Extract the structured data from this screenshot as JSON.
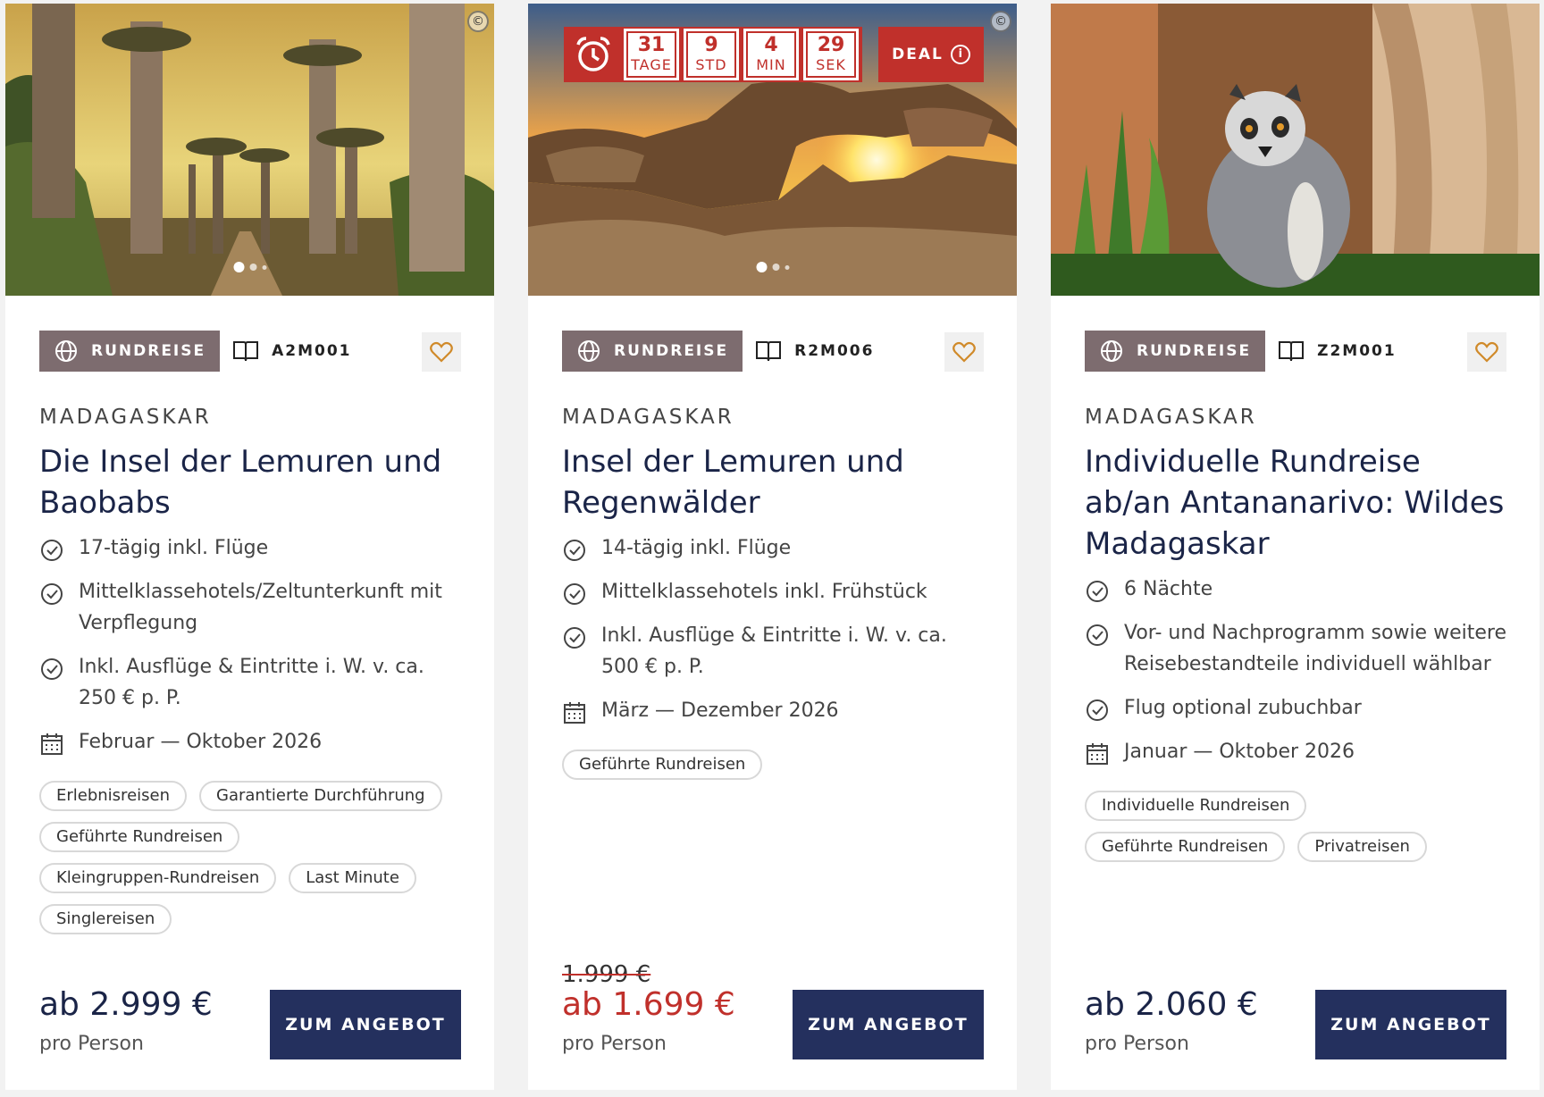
{
  "colors": {
    "accent_red": "#c0302b",
    "navy": "#24305e",
    "badge_bg": "#7d6c6f",
    "heart": "#d08a2a"
  },
  "cards": [
    {
      "type_label": "RUNDREISE",
      "code": "A2M001",
      "country": "MADAGASKAR",
      "title": "Die Insel der Lemuren und Baobabs",
      "features": [
        "17-tägig inkl. Flüge",
        "Mittelklassehotels/Zeltunterkunft mit Verpflegung",
        "Inkl. Ausflüge & Eintritte i. W. v. ca. 250 € p. P."
      ],
      "dates": "Februar — Oktober 2026",
      "tags": [
        "Erlebnisreisen",
        "Garantierte Durchführung",
        "Geführte Rundreisen",
        "Kleingruppen-Rundreisen",
        "Last Minute",
        "Singlereisen"
      ],
      "price": "ab 2.999 €",
      "per_person": "pro Person",
      "cta": "ZUM ANGEBOT",
      "copyright_icon": "©"
    },
    {
      "type_label": "RUNDREISE",
      "code": "R2M006",
      "country": "MADAGASKAR",
      "title": "Insel der Lemuren und Regenwälder",
      "features": [
        "14-tägig inkl. Flüge",
        "Mittelklassehotels inkl. Frühstück",
        "Inkl. Ausflüge & Eintritte i. W. v. ca. 500 € p. P."
      ],
      "dates": "März — Dezember 2026",
      "tags": [
        "Geführte Rundreisen"
      ],
      "old_price": "1.999 €",
      "price": "ab 1.699 €",
      "per_person": "pro Person",
      "cta": "ZUM ANGEBOT",
      "copyright_icon": "©",
      "countdown": {
        "days": "31",
        "days_label": "TAGE",
        "hours": "9",
        "hours_label": "STD",
        "minutes": "4",
        "minutes_label": "MIN",
        "seconds": "29",
        "seconds_label": "SEK"
      },
      "deal_label": "DEAL",
      "deal_info_icon": "i"
    },
    {
      "type_label": "RUNDREISE",
      "code": "Z2M001",
      "country": "MADAGASKAR",
      "title": "Individuelle Rundreise ab/an Antananarivo: Wildes Madagaskar",
      "features": [
        "6 Nächte",
        "Vor- und Nachprogramm sowie weitere Reisebestandteile individuell wählbar",
        "Flug optional zubuchbar"
      ],
      "dates": "Januar — Oktober 2026",
      "tags": [
        "Individuelle Rundreisen",
        "Geführte Rundreisen",
        "Privatreisen"
      ],
      "price": "ab 2.060 €",
      "per_person": "pro Person",
      "cta": "ZUM ANGEBOT"
    }
  ]
}
